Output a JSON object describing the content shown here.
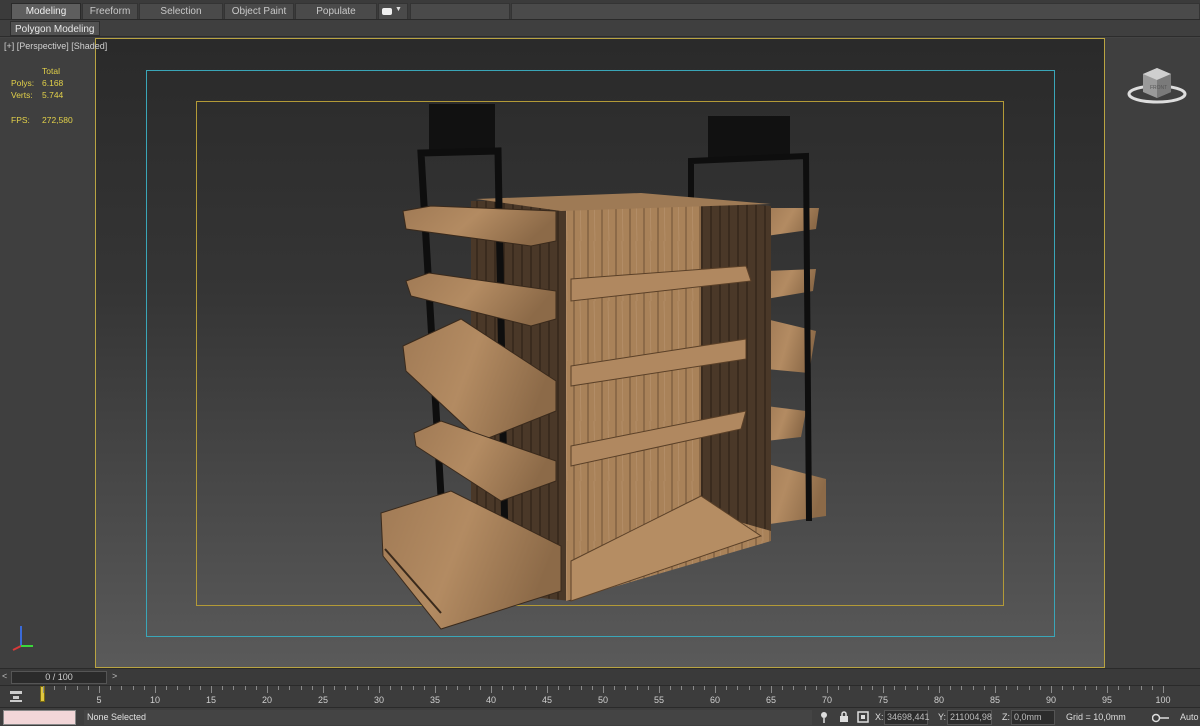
{
  "ribbon": {
    "tabs": [
      {
        "label": "Modeling"
      },
      {
        "label": "Freeform"
      },
      {
        "label": "Selection"
      },
      {
        "label": "Object Paint"
      },
      {
        "label": "Populate"
      }
    ],
    "extra_icon": "camera-icon",
    "dropdown_icon": "chevron-down-icon",
    "sub_button": "Polygon Modeling"
  },
  "viewport": {
    "label": "[+] [Perspective] [Shaded]",
    "stats": {
      "header": "Total",
      "polys_label": "Polys:",
      "polys_value": "6.168",
      "verts_label": "Verts:",
      "verts_value": "5.744",
      "fps_label": "FPS:",
      "fps_value": "272,580"
    },
    "viewcube_label": "FRONT",
    "axis_icon": "xyz-axis-icon",
    "scene": "wooden-shelving-display-model",
    "colors": {
      "safe_frame_outer": "#3aa6b8",
      "safe_frame_inner": "#b39a37",
      "active_border": "#b9a442"
    }
  },
  "timeline": {
    "slider_label": "0 / 100",
    "ticks": [
      "5",
      "10",
      "15",
      "20",
      "25",
      "30",
      "35",
      "40",
      "45",
      "50",
      "55",
      "60",
      "65",
      "70",
      "75",
      "80",
      "85",
      "90",
      "95",
      "100"
    ]
  },
  "status": {
    "selection_text": "None Selected",
    "x_label": "X:",
    "x_value": "34698,441",
    "y_label": "Y:",
    "y_value": "211004,98",
    "z_label": "Z:",
    "z_value": "0,0mm",
    "grid_text": "Grid = 10,0mm",
    "auto_text": "Auto"
  }
}
